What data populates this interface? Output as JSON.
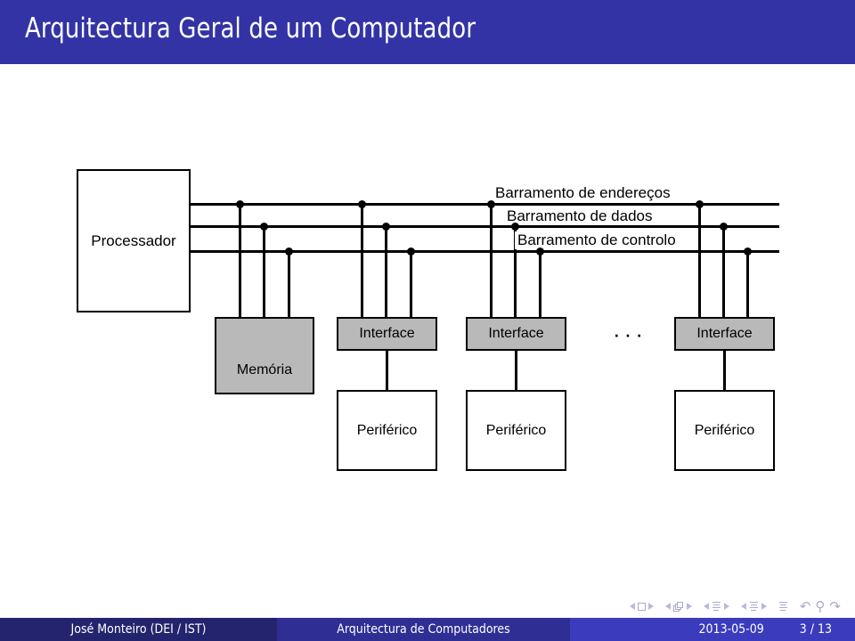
{
  "slide": {
    "title": "Arquitectura Geral de um Computador",
    "title_bar_color": "#3333a6",
    "background_color": "#ffffff"
  },
  "diagram": {
    "type": "block-diagram",
    "processor": {
      "label": "Processador",
      "fill": "#ffffff"
    },
    "memory": {
      "label": "Memória",
      "fill": "#b9b9b9"
    },
    "buses": [
      {
        "id": "enderecos",
        "label": "Barramento de endereços"
      },
      {
        "id": "dados",
        "label": "Barramento de dados"
      },
      {
        "id": "controlo",
        "label": "Barramento de controlo"
      }
    ],
    "interfaces": [
      {
        "label": "Interface",
        "fill": "#b9b9b9"
      },
      {
        "label": "Interface",
        "fill": "#b9b9b9"
      },
      {
        "label": "Interface",
        "fill": "#b9b9b9"
      }
    ],
    "peripherals": [
      {
        "label": "Periférico",
        "fill": "#ffffff"
      },
      {
        "label": "Periférico",
        "fill": "#ffffff"
      },
      {
        "label": "Periférico",
        "fill": "#ffffff"
      }
    ],
    "ellipsis": "···"
  },
  "navigation": {
    "icons": [
      "prev-slide-icon",
      "slide-icon",
      "next-slide-icon",
      "prev-frame-icon",
      "frame-icon",
      "next-frame-icon",
      "prev-subsection-icon",
      "subsection-icon",
      "next-subsection-icon",
      "prev-section-icon",
      "section-icon",
      "next-section-icon",
      "document-icon",
      "back-icon",
      "search-icon",
      "forward-icon"
    ]
  },
  "footer": {
    "author": "José Monteiro  (DEI / IST)",
    "course": "Arquitectura de Computadores",
    "date": "2013-05-09",
    "page": "3 / 13",
    "segment_colors": [
      "#24246e",
      "#2e2e94",
      "#3b3bbd"
    ]
  }
}
